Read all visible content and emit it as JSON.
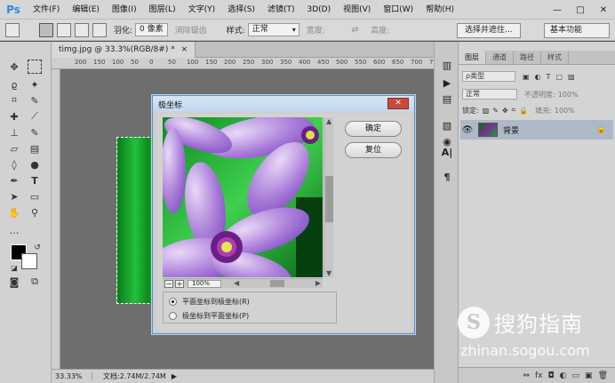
{
  "app": {
    "logo": "Ps",
    "menu": [
      "文件(F)",
      "编辑(E)",
      "图像(I)",
      "图层(L)",
      "文字(Y)",
      "选择(S)",
      "滤镜(T)",
      "3D(D)",
      "视图(V)",
      "窗口(W)",
      "帮助(H)"
    ],
    "window_controls": [
      "—",
      "□",
      "✕"
    ]
  },
  "options": {
    "feather_label": "羽化:",
    "feather_value": "0 像素",
    "antialias_label": "消除锯齿",
    "style_label": "样式:",
    "style_value": "正常",
    "width_label": "宽度:",
    "height_label": "高度:",
    "select_mask_button": "选择并遮住...",
    "workspace_value": "基本功能"
  },
  "document": {
    "tab_title": "timg.jpg @ 33.3%(RGB/8#) *",
    "tab_close": "×",
    "ruler_marks": [
      "200",
      "150",
      "100",
      "50",
      "0",
      "50",
      "100",
      "150",
      "200",
      "250",
      "300",
      "350",
      "400",
      "450",
      "500",
      "550",
      "600",
      "650",
      "700",
      "750"
    ],
    "status_zoom": "33.33%",
    "status_doc": "文档:2.74M/2.74M",
    "status_arrow": "▶"
  },
  "layers_panel": {
    "tabs": [
      "图层",
      "通道",
      "路径",
      "样式"
    ],
    "filter_label": "ρ类型",
    "blend_mode": "正常",
    "opacity_label": "不透明度:",
    "opacity_value": "100%",
    "lock_label": "锁定:",
    "fill_label": "填充:",
    "fill_value": "100%",
    "layer_name": "背景",
    "bottom_icons": [
      "⇔",
      "fx",
      "◘",
      "◐",
      "▭",
      "▣",
      "🗑"
    ]
  },
  "dialog": {
    "title": "极坐标",
    "close_label": "✕",
    "ok_button": "确定",
    "reset_button": "复位",
    "zoom_value": "100%",
    "zoom_minus": "−",
    "zoom_plus": "+",
    "option_rect_to_polar": "平面坐标到极坐标(R)",
    "option_polar_to_rect": "极坐标到平面坐标(P)",
    "selected_option": "rect_to_polar"
  },
  "watermark": {
    "mark": "S",
    "text": "搜狗指南",
    "url": "zhinan.sogou.com"
  },
  "colors": {
    "accent_blue": "#2a8de0",
    "dialog_border": "#5b8fc4",
    "close_red": "#c94a3c",
    "canvas_gray": "#6e6e6e",
    "layer_selected": "#aeb9c7"
  }
}
